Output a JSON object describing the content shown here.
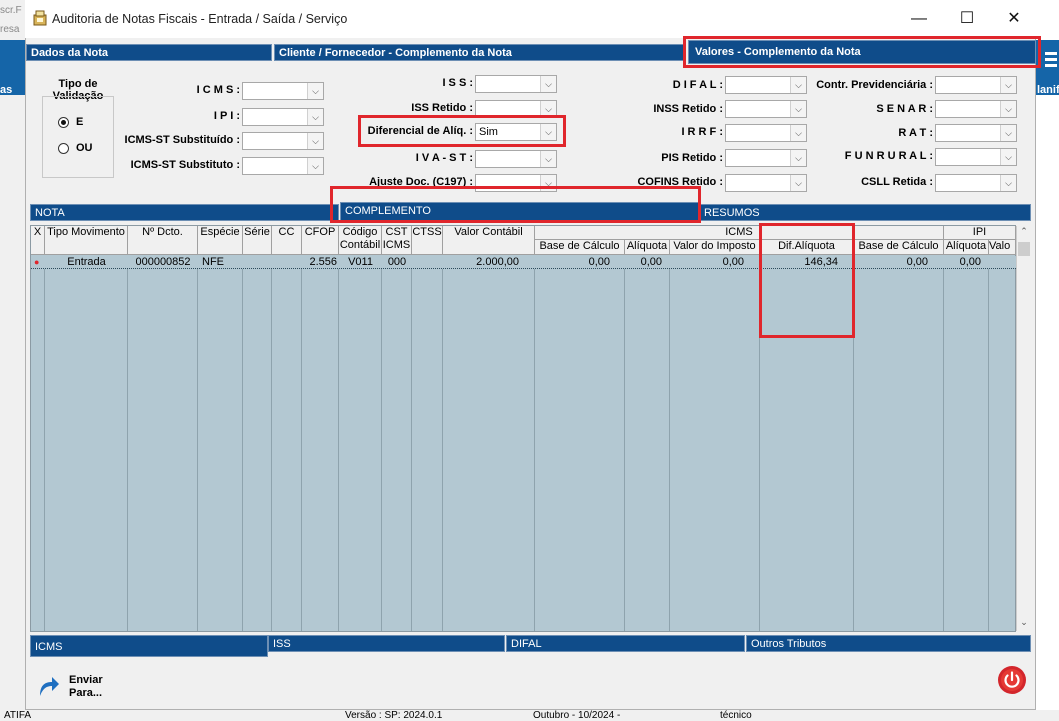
{
  "background": {
    "left_top_1": "scr.F",
    "left_top_2": "resa",
    "left_label": "as",
    "right_label": "lanif",
    "bottom_left": "ATIFA",
    "bottom_status": [
      "Versão : SP: 2024.0.1",
      "Outubro - 10/2024 -",
      "técnico"
    ]
  },
  "window": {
    "title": "Auditoria de Notas Fiscais   -   Entrada / Saída / Serviço",
    "controls": [
      "—",
      "☐",
      "✕"
    ]
  },
  "sections": [
    "Dados da Nota",
    "Cliente / Fornecedor - Complemento da Nota",
    "Valores - Complemento da Nota"
  ],
  "form": {
    "tipo_validacao": {
      "label": "Tipo de Validação",
      "options": [
        "E",
        "OU"
      ],
      "selected": "E"
    },
    "fields": {
      "icms": {
        "label": "I C M S :",
        "value": ""
      },
      "ipi": {
        "label": "I P I :",
        "value": ""
      },
      "icms_st_substituido": {
        "label": "ICMS-ST Substituído :",
        "value": ""
      },
      "icms_st_substituto": {
        "label": "ICMS-ST Substituto :",
        "value": ""
      },
      "iss": {
        "label": "I S S :",
        "value": ""
      },
      "iss_retido": {
        "label": "ISS Retido :",
        "value": ""
      },
      "diferencial_aliq": {
        "label": "Diferencial de Alíq. :",
        "value": "Sim"
      },
      "iva_st": {
        "label": "I V A - S T :",
        "value": ""
      },
      "ajuste_doc": {
        "label": "Ajuste Doc. (C197) :",
        "value": ""
      },
      "difal": {
        "label": "D I F A L :",
        "value": ""
      },
      "inss_retido": {
        "label": "INSS Retido :",
        "value": ""
      },
      "irrf": {
        "label": "I R R F :",
        "value": ""
      },
      "pis_retido": {
        "label": "PIS Retido :",
        "value": ""
      },
      "cofins_retido": {
        "label": "COFINS Retido :",
        "value": ""
      },
      "contr_previdenciaria": {
        "label": "Contr. Previdenciária :",
        "value": ""
      },
      "senar": {
        "label": "S E N A R :",
        "value": ""
      },
      "rat": {
        "label": "R A T :",
        "value": ""
      },
      "funrural": {
        "label": "F U N R U R A L :",
        "value": ""
      },
      "csll_retida": {
        "label": "CSLL Retida :",
        "value": ""
      }
    }
  },
  "tabs_top": [
    "NOTA",
    "COMPLEMENTO",
    "RESUMOS"
  ],
  "grid": {
    "group_headers": [
      "ICMS",
      "IPI"
    ],
    "columns": [
      "X",
      "Tipo Movimento",
      "Nº Dcto.",
      "Espécie",
      "Série",
      "CC",
      "CFOP",
      "Código Contábil",
      "CST ICMS",
      "CTSS",
      "Valor Contábil",
      "Base de Cálculo",
      "Alíquota",
      "Valor do Imposto",
      "Dif.Alíquota",
      "Base de Cálculo",
      "Alíquota",
      "Valo"
    ],
    "rows": [
      [
        "●",
        "Entrada",
        "000000852",
        "NFE",
        "",
        "",
        "2.556",
        "V011",
        "000",
        "",
        "2.000,00",
        "0,00",
        "0,00",
        "0,00",
        "146,34",
        "0,00",
        "0,00",
        ""
      ]
    ]
  },
  "tabs_bottom": [
    "ICMS",
    "ISS",
    "DIFAL",
    "Outros Tributos"
  ],
  "actions": {
    "send": "Enviar Para...",
    "accent": "#0f4c8a",
    "highlight": "#e0262c"
  }
}
